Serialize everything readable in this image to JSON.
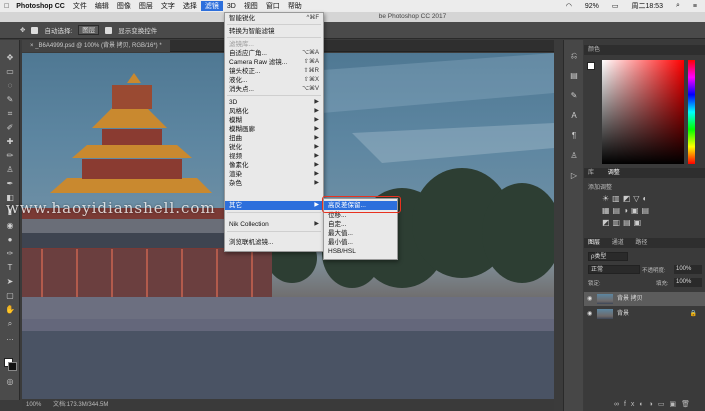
{
  "menubar": {
    "app": "Photoshop CC",
    "items": [
      "文件",
      "编辑",
      "图像",
      "图层",
      "文字",
      "选择",
      "滤镜",
      "3D",
      "视图",
      "窗口",
      "帮助"
    ],
    "active_index": 6,
    "status": {
      "battery": "92%",
      "clock": "周二18:53"
    }
  },
  "window_title": "be Photoshop CC 2017",
  "options_bar": {
    "auto_select_label": "自动选择:",
    "auto_select_value": "图层",
    "show_transform": "显示变换控件"
  },
  "document_tab": "_B6A4999.psd @ 100% (背景 拷贝, RGB/16*) *",
  "status_bar": {
    "zoom": "100%",
    "doc_size": "文档:173.3M/344.5M"
  },
  "watermark": "www.haoyidianshell.com",
  "filter_menu": [
    {
      "label": "智能锐化",
      "shortcut": "^⌘F",
      "disabled": false
    },
    {
      "label": "转换为智能滤镜",
      "shortcut": "",
      "disabled": false
    },
    {
      "label": "滤镜库...",
      "shortcut": "",
      "disabled": true
    },
    {
      "label": "自适应广角...",
      "shortcut": "⌥⌘A",
      "disabled": false
    },
    {
      "label": "Camera Raw 滤镜...",
      "shortcut": "⇧⌘A",
      "disabled": false
    },
    {
      "label": "镜头校正...",
      "shortcut": "⇧⌘R",
      "disabled": false
    },
    {
      "label": "液化...",
      "shortcut": "⇧⌘X",
      "disabled": false
    },
    {
      "label": "消失点...",
      "shortcut": "⌥⌘V",
      "disabled": false
    },
    {
      "label": "3D",
      "shortcut": "",
      "disabled": false
    },
    {
      "label": "风格化",
      "shortcut": "",
      "disabled": false
    },
    {
      "label": "模糊",
      "shortcut": "",
      "disabled": false
    },
    {
      "label": "模糊画廊",
      "shortcut": "",
      "disabled": false
    },
    {
      "label": "扭曲",
      "shortcut": "",
      "disabled": false
    },
    {
      "label": "锐化",
      "shortcut": "",
      "disabled": false
    },
    {
      "label": "视频",
      "shortcut": "",
      "disabled": false
    },
    {
      "label": "像素化",
      "shortcut": "",
      "disabled": false
    },
    {
      "label": "渲染",
      "shortcut": "",
      "disabled": false
    },
    {
      "label": "杂色",
      "shortcut": "",
      "disabled": false
    },
    {
      "label": "其它",
      "shortcut": "",
      "disabled": false
    },
    {
      "label": "Nik Collection",
      "shortcut": "",
      "disabled": false
    },
    {
      "label": "浏览联机滤镜...",
      "shortcut": "",
      "disabled": false
    }
  ],
  "other_submenu": [
    "高反差保留...",
    "位移...",
    "自定...",
    "最大值...",
    "最小值...",
    "HSB/HSL"
  ],
  "panels": {
    "color_tab": "颜色",
    "adjust_tabs": [
      "库",
      "调整"
    ],
    "add_adjustment": "添加调整",
    "layers_tabs": [
      "图层",
      "通道",
      "路径"
    ],
    "kind": "ρ类型",
    "blend_mode": "正常",
    "opacity_label": "不透明度:",
    "opacity_value": "100%",
    "lock_label": "锁定:",
    "fill_label": "填充:",
    "fill_value": "100%",
    "layers": [
      "背景 拷贝",
      "背景"
    ]
  }
}
